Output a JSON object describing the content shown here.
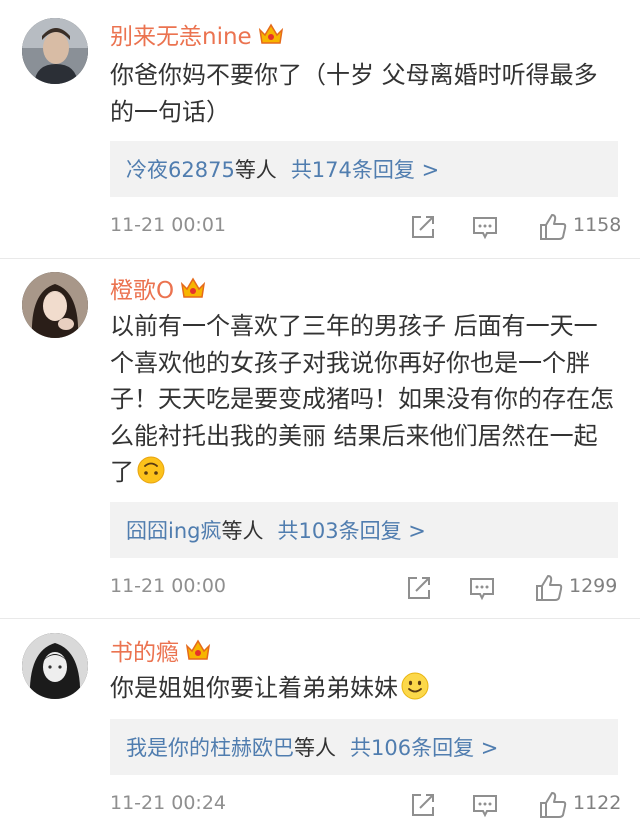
{
  "colors": {
    "username": "#eb7350",
    "reply_link": "#507daf",
    "reply_bg": "#f2f2f2",
    "meta": "#8f8f8f"
  },
  "comments": [
    {
      "user": "别来无恙nine",
      "badge_icon": "vip-crown-icon",
      "text": "你爸你妈不要你了（十岁 父母离婚时听得最多的一句话）",
      "reply_users": "冷夜62875",
      "reply_others": "等人",
      "reply_count": "共174条回复 >",
      "time": "11-21 00:01",
      "likes": "1158"
    },
    {
      "user": "橙歌O",
      "badge_icon": "vip-crown-icon",
      "text": "以前有一个喜欢了三年的男孩子 后面有一天一个喜欢他的女孩子对我说你再好你也是一个胖子！天天吃是要变成猪吗！如果没有你的存在怎么能衬托出我的美丽 结果后来他们居然在一起了",
      "emoji": "upside-down-face-emoji",
      "reply_users": "囧囧ing疯",
      "reply_others": "等人",
      "reply_count": "共103条回复 >",
      "time": "11-21 00:00",
      "likes": "1299"
    },
    {
      "user": "书的瘾",
      "badge_icon": "vip-crown-icon",
      "text": "你是姐姐你要让着弟弟妹妹",
      "emoji": "smile-face-emoji",
      "reply_users": "我是你的柱赫欧巴",
      "reply_others": "等人",
      "reply_count": "共106条回复 >",
      "time": "11-21 00:24",
      "likes": "1122"
    }
  ]
}
